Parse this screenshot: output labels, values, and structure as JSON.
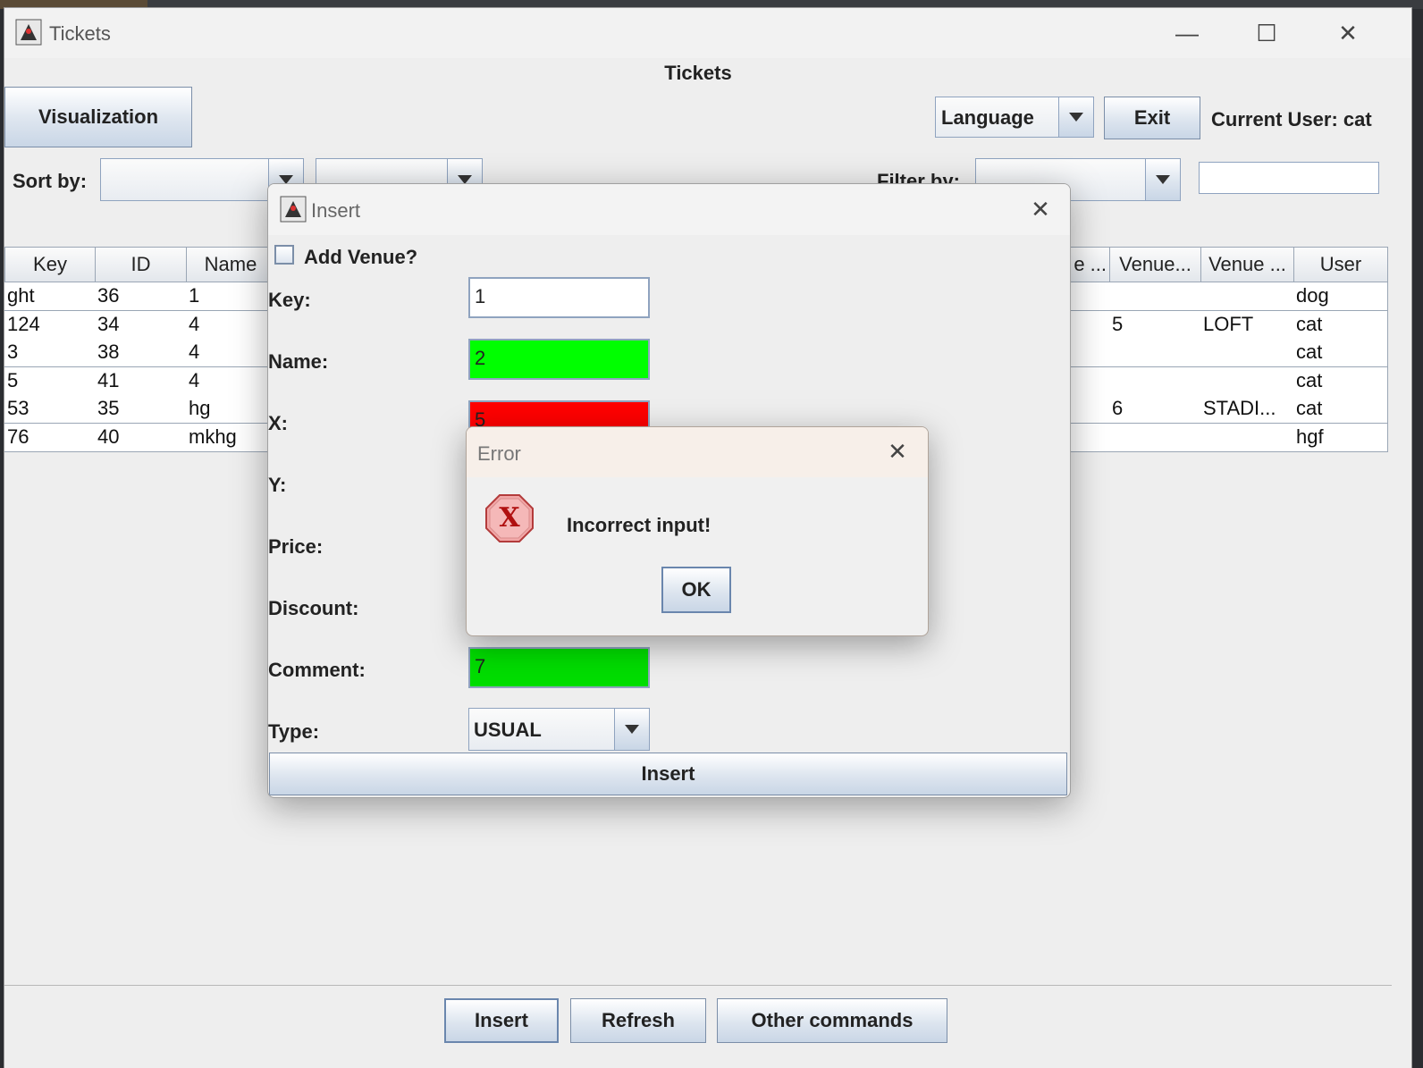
{
  "window": {
    "title": "Tickets",
    "heading": "Tickets",
    "minimize_glyph": "—",
    "maximize_glyph": "☐",
    "close_glyph": "✕"
  },
  "toolbar": {
    "visualization_label": "Visualization",
    "language_label": "Language",
    "exit_label": "Exit",
    "current_user_label": "Current User: cat",
    "sort_by_label": "Sort by:",
    "filter_by_label": "Filter by:"
  },
  "table": {
    "left_headers": [
      "Key",
      "ID",
      "Name"
    ],
    "right_headers": [
      "e ...",
      "Venue...",
      "Venue ...",
      "User"
    ],
    "left_rows": [
      [
        "ght",
        "36",
        "1"
      ],
      [
        "124",
        "34",
        "4"
      ],
      [
        "3",
        "38",
        "4"
      ],
      [
        "5",
        "41",
        "4"
      ],
      [
        "53",
        "35",
        "hg"
      ],
      [
        "76",
        "40",
        "mkhg"
      ]
    ],
    "right_rows": [
      [
        "",
        "",
        "",
        "dog"
      ],
      [
        "",
        "5",
        "LOFT",
        "cat"
      ],
      [
        "",
        "",
        "",
        "cat"
      ],
      [
        "",
        "",
        "",
        "cat"
      ],
      [
        "",
        "6",
        "STADI...",
        "cat"
      ],
      [
        "",
        "",
        "",
        "hgf"
      ]
    ]
  },
  "insert_dialog": {
    "title": "Insert",
    "close_glyph": "✕",
    "add_venue_label": "Add Venue?",
    "key_label": "Key:",
    "key_value": "1",
    "name_label": "Name:",
    "name_value": "2",
    "x_label": "X:",
    "x_value": "5",
    "y_label": "Y:",
    "price_label": "Price:",
    "discount_label": "Discount:",
    "comment_label": "Comment:",
    "comment_value": "7",
    "type_label": "Type:",
    "type_value": "USUAL",
    "insert_button": "Insert"
  },
  "error_dialog": {
    "title": "Error",
    "close_glyph": "✕",
    "message": "Incorrect input!",
    "icon_glyph": "X",
    "ok_label": "OK"
  },
  "bottom_bar": {
    "insert_label": "Insert",
    "refresh_label": "Refresh",
    "other_commands_label": "Other commands"
  },
  "colors": {
    "valid_field": "#00ff00",
    "invalid_field": "#ff0000",
    "window_bg": "#eeeeee"
  }
}
